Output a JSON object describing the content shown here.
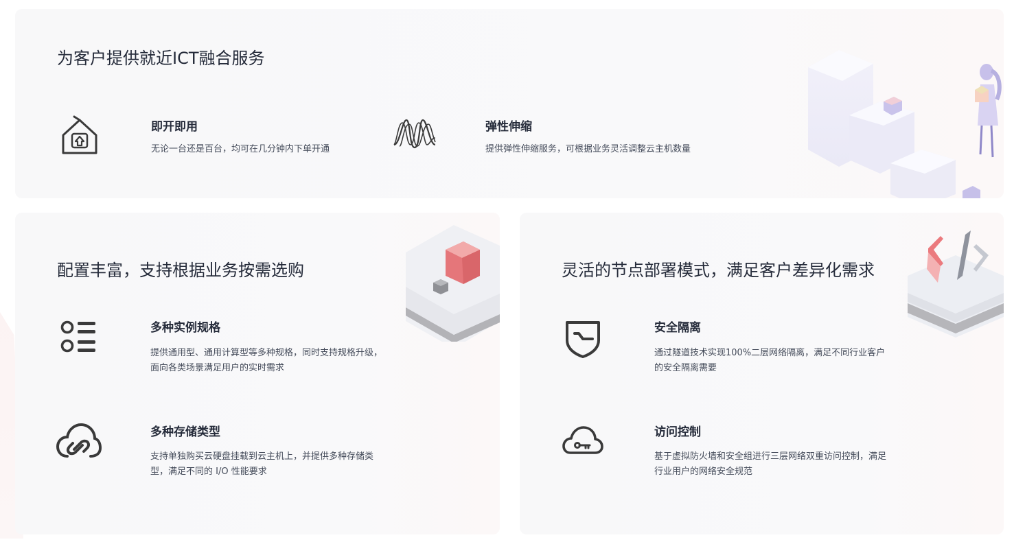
{
  "cards": [
    {
      "title": "为客户提供就近ICT融合服务",
      "features": [
        {
          "icon": "house-upload-icon",
          "title": "即开即用",
          "desc": "无论一台还是百台，均可在几分钟内下单开通"
        },
        {
          "icon": "wave-icon",
          "title": "弹性伸缩",
          "desc": "提供弹性伸缩服务，可根据业务灵活调整云主机数量"
        }
      ]
    },
    {
      "title": "配置丰富，支持根据业务按需选购",
      "features": [
        {
          "icon": "list-icon",
          "title": "多种实例规格",
          "desc": "提供通用型、通用计算型等多种规格，同时支持规格升级，面向各类场景满足用户的实时需求"
        },
        {
          "icon": "cloud-link-icon",
          "title": "多种存储类型",
          "desc": "支持单独购买云硬盘挂载到云主机上，并提供多种存储类型，满足不同的 I/O 性能要求"
        }
      ]
    },
    {
      "title": "灵活的节点部署模式，满足客户差异化需求",
      "features": [
        {
          "icon": "shield-icon",
          "title": "安全隔离",
          "desc": "通过隧道技术实现100%二层网络隔离，满足不同行业客户的安全隔离需要"
        },
        {
          "icon": "cloud-key-icon",
          "title": "访问控制",
          "desc": "基于虚拟防火墙和安全组进行三层网络双重访问控制，满足行业用户的网络安全规范"
        }
      ]
    }
  ]
}
